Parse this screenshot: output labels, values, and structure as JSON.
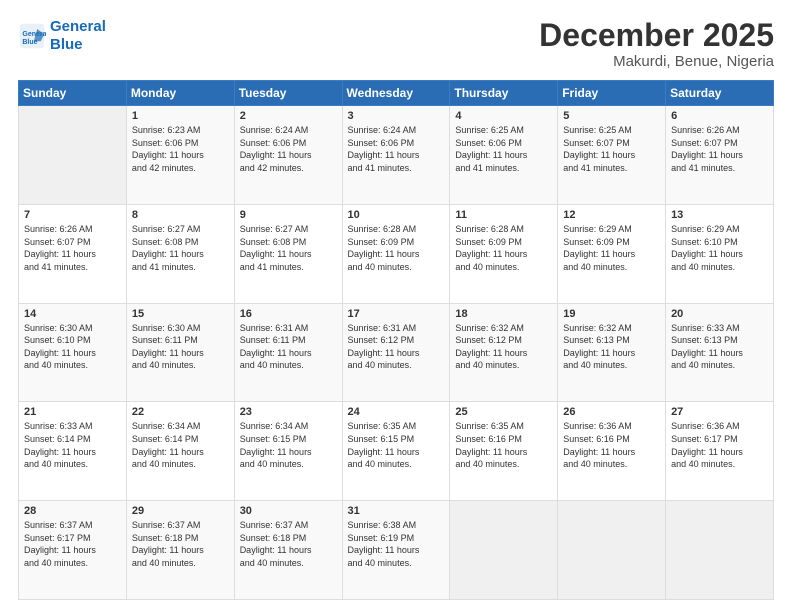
{
  "logo": {
    "line1": "General",
    "line2": "Blue"
  },
  "title": "December 2025",
  "location": "Makurdi, Benue, Nigeria",
  "weekdays": [
    "Sunday",
    "Monday",
    "Tuesday",
    "Wednesday",
    "Thursday",
    "Friday",
    "Saturday"
  ],
  "weeks": [
    [
      {
        "num": "",
        "info": ""
      },
      {
        "num": "1",
        "info": "Sunrise: 6:23 AM\nSunset: 6:06 PM\nDaylight: 11 hours\nand 42 minutes."
      },
      {
        "num": "2",
        "info": "Sunrise: 6:24 AM\nSunset: 6:06 PM\nDaylight: 11 hours\nand 42 minutes."
      },
      {
        "num": "3",
        "info": "Sunrise: 6:24 AM\nSunset: 6:06 PM\nDaylight: 11 hours\nand 41 minutes."
      },
      {
        "num": "4",
        "info": "Sunrise: 6:25 AM\nSunset: 6:06 PM\nDaylight: 11 hours\nand 41 minutes."
      },
      {
        "num": "5",
        "info": "Sunrise: 6:25 AM\nSunset: 6:07 PM\nDaylight: 11 hours\nand 41 minutes."
      },
      {
        "num": "6",
        "info": "Sunrise: 6:26 AM\nSunset: 6:07 PM\nDaylight: 11 hours\nand 41 minutes."
      }
    ],
    [
      {
        "num": "7",
        "info": "Sunrise: 6:26 AM\nSunset: 6:07 PM\nDaylight: 11 hours\nand 41 minutes."
      },
      {
        "num": "8",
        "info": "Sunrise: 6:27 AM\nSunset: 6:08 PM\nDaylight: 11 hours\nand 41 minutes."
      },
      {
        "num": "9",
        "info": "Sunrise: 6:27 AM\nSunset: 6:08 PM\nDaylight: 11 hours\nand 41 minutes."
      },
      {
        "num": "10",
        "info": "Sunrise: 6:28 AM\nSunset: 6:09 PM\nDaylight: 11 hours\nand 40 minutes."
      },
      {
        "num": "11",
        "info": "Sunrise: 6:28 AM\nSunset: 6:09 PM\nDaylight: 11 hours\nand 40 minutes."
      },
      {
        "num": "12",
        "info": "Sunrise: 6:29 AM\nSunset: 6:09 PM\nDaylight: 11 hours\nand 40 minutes."
      },
      {
        "num": "13",
        "info": "Sunrise: 6:29 AM\nSunset: 6:10 PM\nDaylight: 11 hours\nand 40 minutes."
      }
    ],
    [
      {
        "num": "14",
        "info": "Sunrise: 6:30 AM\nSunset: 6:10 PM\nDaylight: 11 hours\nand 40 minutes."
      },
      {
        "num": "15",
        "info": "Sunrise: 6:30 AM\nSunset: 6:11 PM\nDaylight: 11 hours\nand 40 minutes."
      },
      {
        "num": "16",
        "info": "Sunrise: 6:31 AM\nSunset: 6:11 PM\nDaylight: 11 hours\nand 40 minutes."
      },
      {
        "num": "17",
        "info": "Sunrise: 6:31 AM\nSunset: 6:12 PM\nDaylight: 11 hours\nand 40 minutes."
      },
      {
        "num": "18",
        "info": "Sunrise: 6:32 AM\nSunset: 6:12 PM\nDaylight: 11 hours\nand 40 minutes."
      },
      {
        "num": "19",
        "info": "Sunrise: 6:32 AM\nSunset: 6:13 PM\nDaylight: 11 hours\nand 40 minutes."
      },
      {
        "num": "20",
        "info": "Sunrise: 6:33 AM\nSunset: 6:13 PM\nDaylight: 11 hours\nand 40 minutes."
      }
    ],
    [
      {
        "num": "21",
        "info": "Sunrise: 6:33 AM\nSunset: 6:14 PM\nDaylight: 11 hours\nand 40 minutes."
      },
      {
        "num": "22",
        "info": "Sunrise: 6:34 AM\nSunset: 6:14 PM\nDaylight: 11 hours\nand 40 minutes."
      },
      {
        "num": "23",
        "info": "Sunrise: 6:34 AM\nSunset: 6:15 PM\nDaylight: 11 hours\nand 40 minutes."
      },
      {
        "num": "24",
        "info": "Sunrise: 6:35 AM\nSunset: 6:15 PM\nDaylight: 11 hours\nand 40 minutes."
      },
      {
        "num": "25",
        "info": "Sunrise: 6:35 AM\nSunset: 6:16 PM\nDaylight: 11 hours\nand 40 minutes."
      },
      {
        "num": "26",
        "info": "Sunrise: 6:36 AM\nSunset: 6:16 PM\nDaylight: 11 hours\nand 40 minutes."
      },
      {
        "num": "27",
        "info": "Sunrise: 6:36 AM\nSunset: 6:17 PM\nDaylight: 11 hours\nand 40 minutes."
      }
    ],
    [
      {
        "num": "28",
        "info": "Sunrise: 6:37 AM\nSunset: 6:17 PM\nDaylight: 11 hours\nand 40 minutes."
      },
      {
        "num": "29",
        "info": "Sunrise: 6:37 AM\nSunset: 6:18 PM\nDaylight: 11 hours\nand 40 minutes."
      },
      {
        "num": "30",
        "info": "Sunrise: 6:37 AM\nSunset: 6:18 PM\nDaylight: 11 hours\nand 40 minutes."
      },
      {
        "num": "31",
        "info": "Sunrise: 6:38 AM\nSunset: 6:19 PM\nDaylight: 11 hours\nand 40 minutes."
      },
      {
        "num": "",
        "info": ""
      },
      {
        "num": "",
        "info": ""
      },
      {
        "num": "",
        "info": ""
      }
    ]
  ]
}
